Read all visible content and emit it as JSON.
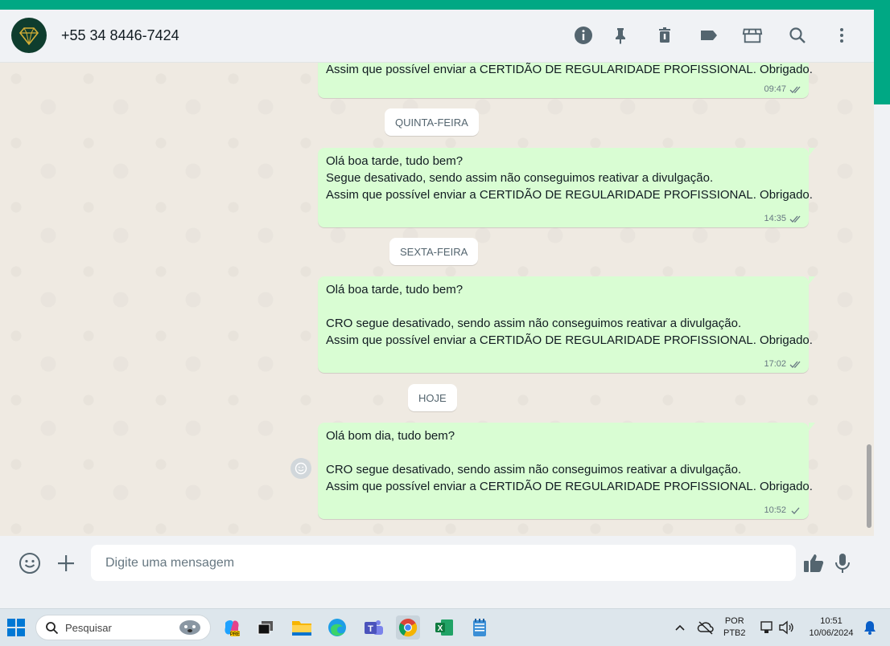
{
  "header": {
    "contact_name": "+55 34 8446-7424",
    "icons": [
      "info-icon",
      "pin-icon",
      "delete-icon",
      "label-icon",
      "catalog-icon",
      "search-icon",
      "menu-icon"
    ]
  },
  "messages": [
    {
      "lines": [
        "Assim que possível enviar a CERTIDÃO DE REGULARIDADE PROFISSIONAL. Obrigado."
      ],
      "time": "09:47",
      "status": "read"
    },
    {
      "lines": [
        "Olá boa tarde, tudo bem?",
        "Segue desativado, sendo assim não conseguimos reativar a divulgação.",
        "Assim que possível enviar a CERTIDÃO DE REGULARIDADE PROFISSIONAL. Obrigado."
      ],
      "time": "14:35",
      "status": "read"
    },
    {
      "lines": [
        "Olá boa tarde, tudo bem?",
        "",
        "CRO segue desativado, sendo assim não conseguimos reativar a divulgação.",
        "Assim que possível enviar a CERTIDÃO DE REGULARIDADE PROFISSIONAL. Obrigado."
      ],
      "time": "17:02",
      "status": "read"
    },
    {
      "lines": [
        "Olá bom dia, tudo bem?",
        "",
        "CRO segue desativado, sendo assim não conseguimos reativar a divulgação.",
        "Assim que possível enviar a CERTIDÃO DE REGULARIDADE PROFISSIONAL. Obrigado."
      ],
      "time": "10:52",
      "status": "sent"
    }
  ],
  "day_separators": [
    "QUINTA-FEIRA",
    "SEXTA-FEIRA",
    "HOJE"
  ],
  "composer": {
    "placeholder": "Digite uma mensagem"
  },
  "taskbar": {
    "search_label": "Pesquisar",
    "language": "POR",
    "layout": "PTB2",
    "time": "10:51",
    "date": "10/06/2024",
    "apps": [
      "copilot-icon",
      "task-view-icon",
      "file-explorer-icon",
      "edge-icon",
      "teams-icon",
      "chrome-icon",
      "excel-icon",
      "notepad-icon"
    ]
  },
  "colors": {
    "accent": "#00a884",
    "outgoing_bubble": "#d9fdd3",
    "read_ticks": "#667781"
  }
}
